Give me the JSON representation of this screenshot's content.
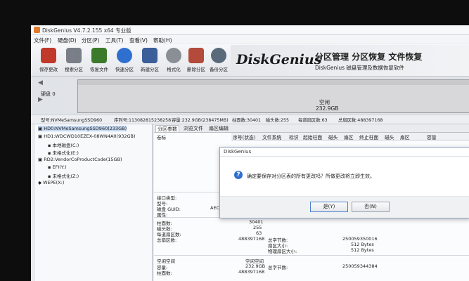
{
  "window": {
    "title": "DiskGenius V4.7.2.155 x64 专业版"
  },
  "menu": [
    "文件(F)",
    "硬盘(D)",
    "分区(P)",
    "工具(T)",
    "查看(V)",
    "帮助(H)"
  ],
  "toolbar": [
    {
      "label": "保存更改",
      "icon": "save-icon",
      "color": "#c0392b"
    },
    {
      "label": "搜索分区",
      "icon": "search-partition-icon",
      "color": "#7a7f87"
    },
    {
      "label": "恢复文件",
      "icon": "recover-file-icon",
      "color": "#3b7a2a"
    },
    {
      "label": "快速分区",
      "icon": "quick-partition-icon",
      "color": "#2f6fd0"
    },
    {
      "label": "新建分区",
      "icon": "new-partition-icon",
      "color": "#3c5f9a"
    },
    {
      "label": "格式化",
      "icon": "format-icon",
      "color": "#8a8f96"
    },
    {
      "label": "删除分区",
      "icon": "delete-partition-icon",
      "color": "#b34a3a"
    },
    {
      "label": "备份分区",
      "icon": "backup-partition-icon",
      "color": "#5a6a7a"
    }
  ],
  "brand": {
    "logo_main": "DiskGenius",
    "tagline": "分区管理 分区恢复 文件恢复",
    "subtag": "DiskGenius 磁盘管理及数据恢复软件"
  },
  "diskmap": {
    "disk_label": "硬盘 0",
    "free_label": "空闲",
    "free_size": "232.9GB"
  },
  "infobar": {
    "model": "型号:NVMeSamsungSSD960",
    "serial": "序列号:113082815238258",
    "capacity": "容量:232.9GB(238475MB)",
    "cylinders": "柱面数:30401",
    "heads": "磁头数:255",
    "sectors": "每道扇区数:63",
    "total_sectors": "总扇区数:488397168"
  },
  "tree": [
    {
      "text": "HD0:NVMeSamsungSSD960(233GB)",
      "selected": true
    },
    {
      "text": "HD1:WDCWD10EZEX-08WN4A0(932GB)",
      "selected": false
    },
    {
      "text": "本地磁盘(C:)",
      "selected": false
    },
    {
      "text": "未格式化(E:)",
      "selected": false
    },
    {
      "text": "RD2:VendorCoProductCode(15GB)",
      "selected": false
    },
    {
      "text": "EFI(Y:)",
      "selected": false
    },
    {
      "text": "未格式化(Z:)",
      "selected": false
    },
    {
      "text": "WEPE(X:)",
      "selected": false
    }
  ],
  "tabs": [
    "分区参数",
    "浏览文件",
    "扇区编辑"
  ],
  "table": {
    "volume_label_header": "卷标",
    "columns": [
      "序号(状态)",
      "文件系统",
      "标识",
      "起始柱面",
      "磁头",
      "扇区",
      "终止柱面",
      "磁头",
      "扇区",
      "容量"
    ]
  },
  "details": {
    "iface_label": "接口类型:",
    "model_label": "型号:",
    "guid_label": "磁盘 GUID:",
    "guid_value": "AECO",
    "attr_label": "属性:",
    "cyl_label": "柱面数:",
    "cyl_value": "30401",
    "heads_label": "磁头数:",
    "heads_value": "255",
    "spt_label": "每道扇区数:",
    "spt_value": "63",
    "total_label": "总扇区数:",
    "total_value": "488397168",
    "bytes_label": "总字节数:",
    "bytes_value": "250059350016",
    "sector_size_label": "扇区大小:",
    "sector_size_value": "512 Bytes",
    "phys_label": "物理扇区大小:",
    "phys_value": "512 Bytes",
    "free_section_label": "空闲空间",
    "free_cap_label": "容量:",
    "free_cap_value": "232.9GB",
    "free_bytes_label": "总字节数:",
    "free_bytes_value": "250059344384",
    "free_cyl_label": "柱面数:",
    "free_cyl_value": "488397168"
  },
  "dialog": {
    "title": "DiskGenius",
    "message": "确定要保存对分区表的所有更改吗？所做更改将立即生效。",
    "yes": "是(Y)",
    "no": "否(N)"
  }
}
